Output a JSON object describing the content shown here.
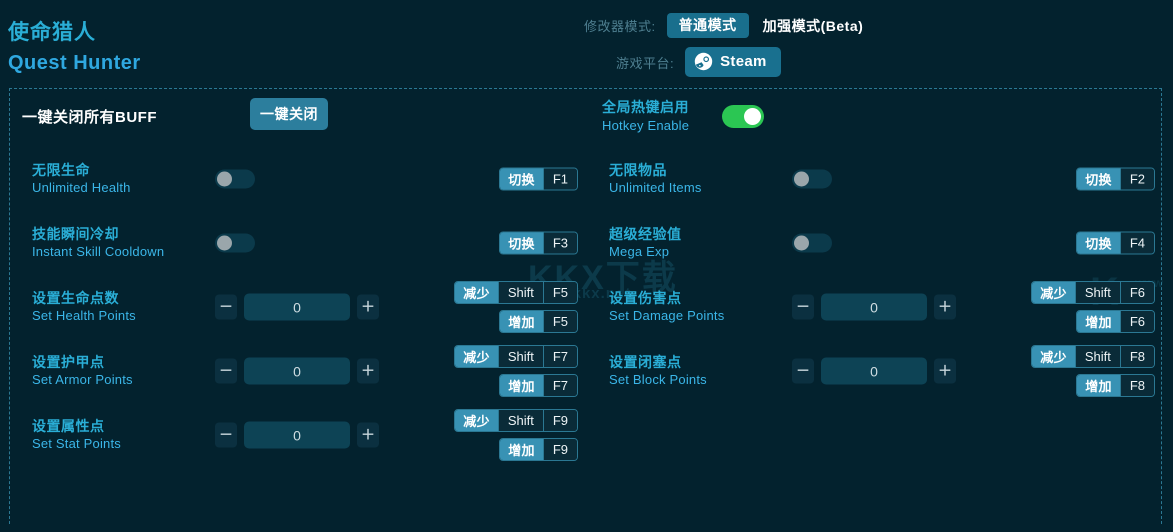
{
  "app": {
    "title_cn": "使命猎人",
    "title_en": "Quest Hunter"
  },
  "header": {
    "mode_label": "修改器模式:",
    "mode_selected": "普通模式",
    "mode_alt": "加强模式(Beta)",
    "platform_label": "游戏平台:",
    "platform_value": "Steam",
    "platform_icon": "steam-icon"
  },
  "topbar": {
    "buff_label": "一键关闭所有BUFF",
    "buff_button": "一键关闭",
    "hotkey_cn": "全局热键启用",
    "hotkey_en": "Hotkey Enable",
    "hotkey_state": "on"
  },
  "colors": {
    "background": "#03222e",
    "accent": "#2aaed6",
    "accent_en": "#3bb6e8",
    "button": "#2c7e9d",
    "steam_button": "#19708f",
    "key_action": "#3892b4",
    "key_dark": "#0a2b38",
    "toggle_on": "#2bc653",
    "toggle_off": "#0b3a4b",
    "dashed_border": "#2b7893"
  },
  "watermark": {
    "text_cn": "KKX下载",
    "text_url": "www.kkx.net",
    "corner_mark": "K",
    "corner_sub": "www"
  },
  "left_rows": [
    {
      "cn": "无限生命",
      "en": "Unlimited Health",
      "control": "toggle",
      "state": "off",
      "keys": [
        {
          "action": "切换",
          "combo": [
            "F1"
          ]
        }
      ]
    },
    {
      "cn": "技能瞬间冷却",
      "en": "Instant Skill Cooldown",
      "control": "toggle",
      "state": "off",
      "keys": [
        {
          "action": "切换",
          "combo": [
            "F3"
          ]
        }
      ]
    },
    {
      "cn": "设置生命点数",
      "en": "Set Health Points",
      "control": "stepper",
      "value": "0",
      "minus": "−",
      "plus": "+",
      "keys": [
        {
          "action": "减少",
          "combo": [
            "Shift",
            "F5"
          ]
        },
        {
          "action": "增加",
          "combo": [
            "F5"
          ]
        }
      ]
    },
    {
      "cn": "设置护甲点",
      "en": "Set Armor Points",
      "control": "stepper",
      "value": "0",
      "minus": "−",
      "plus": "+",
      "keys": [
        {
          "action": "减少",
          "combo": [
            "Shift",
            "F7"
          ]
        },
        {
          "action": "增加",
          "combo": [
            "F7"
          ]
        }
      ]
    },
    {
      "cn": "设置属性点",
      "en": "Set Stat Points",
      "control": "stepper",
      "value": "0",
      "minus": "−",
      "plus": "+",
      "keys": [
        {
          "action": "减少",
          "combo": [
            "Shift",
            "F9"
          ]
        },
        {
          "action": "增加",
          "combo": [
            "F9"
          ]
        }
      ]
    }
  ],
  "right_rows": [
    {
      "cn": "无限物品",
      "en": "Unlimited Items",
      "control": "toggle",
      "state": "off",
      "keys": [
        {
          "action": "切换",
          "combo": [
            "F2"
          ]
        }
      ]
    },
    {
      "cn": "超级经验值",
      "en": "Mega Exp",
      "control": "toggle",
      "state": "off",
      "keys": [
        {
          "action": "切换",
          "combo": [
            "F4"
          ]
        }
      ]
    },
    {
      "cn": "设置伤害点",
      "en": "Set Damage Points",
      "control": "stepper",
      "value": "0",
      "minus": "−",
      "plus": "+",
      "keys": [
        {
          "action": "减少",
          "combo": [
            "Shift",
            "F6"
          ]
        },
        {
          "action": "增加",
          "combo": [
            "F6"
          ]
        }
      ]
    },
    {
      "cn": "设置闭塞点",
      "en": "Set Block Points",
      "control": "stepper",
      "value": "0",
      "minus": "−",
      "plus": "+",
      "keys": [
        {
          "action": "减少",
          "combo": [
            "Shift",
            "F8"
          ]
        },
        {
          "action": "增加",
          "combo": [
            "F8"
          ]
        }
      ]
    }
  ]
}
